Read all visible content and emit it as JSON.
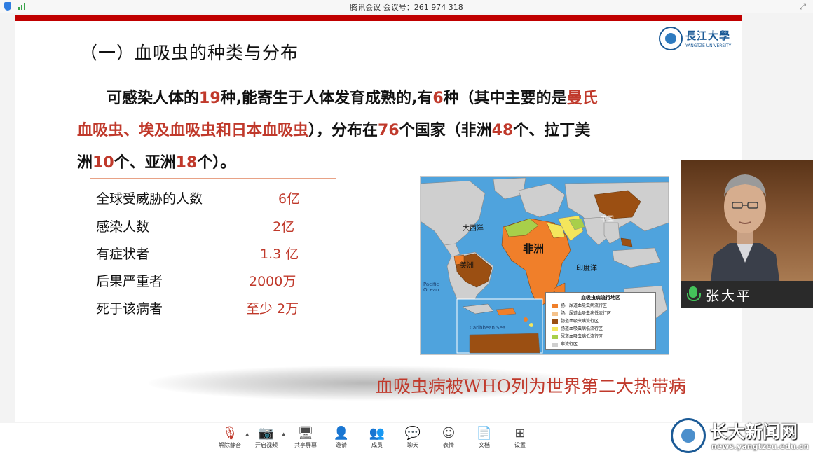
{
  "window": {
    "title": "腾讯会议 会议号：261 974 318"
  },
  "slide": {
    "title": "（一）血吸虫的种类与分布",
    "logo": {
      "cn": "長江大學",
      "en": "YANGTZE UNIVERSITY"
    },
    "paragraph": {
      "line1": [
        {
          "text": "可感染人体的",
          "hl": false
        },
        {
          "text": "19",
          "hl": true
        },
        {
          "text": "种,能寄生于人体发育成熟的,有",
          "hl": false
        },
        {
          "text": "6",
          "hl": true
        },
        {
          "text": "种（其中主要的是",
          "hl": false
        },
        {
          "text": "曼氏",
          "hl": true
        }
      ],
      "line2": [
        {
          "text": "血吸虫、埃及血吸虫和日本血吸虫",
          "hl": true
        },
        {
          "text": "），分布在",
          "hl": false
        },
        {
          "text": "76",
          "hl": true
        },
        {
          "text": "个国家（非洲",
          "hl": false
        },
        {
          "text": "48",
          "hl": true
        },
        {
          "text": "个、拉丁美",
          "hl": false
        }
      ],
      "line3": [
        {
          "text": "洲",
          "hl": false
        },
        {
          "text": "10",
          "hl": true
        },
        {
          "text": "个、亚洲",
          "hl": false
        },
        {
          "text": "18",
          "hl": true
        },
        {
          "text": "个）。",
          "hl": false
        }
      ]
    },
    "stats": [
      {
        "label": "全球受威胁的人数",
        "value": "6亿"
      },
      {
        "label": "感染人数",
        "value": "2亿"
      },
      {
        "label": "有症状者",
        "value": "1.3 亿"
      },
      {
        "label": "后果严重者",
        "value": "2000万"
      },
      {
        "label": "死于该病者",
        "value": "至少 2万"
      }
    ],
    "map": {
      "labels": {
        "atlantic": "大西洋",
        "africa": "非洲",
        "china": "中国",
        "americas": "美洲",
        "indian": "印度洋",
        "pacific": "Pacific Ocean",
        "caribbean": "Caribbean Sea"
      },
      "legend": {
        "title": "血吸虫病流行地区",
        "items": [
          {
            "text": "肠、尿道血吸虫病流行区",
            "color": "#f07f2a"
          },
          {
            "text": "肠、尿道血吸虫病低流行区",
            "color": "#f5c28b"
          },
          {
            "text": "肠道血吸虫病流行区",
            "color": "#9b4f12"
          },
          {
            "text": "肠道血吸虫病低流行区",
            "color": "#f4e65c"
          },
          {
            "text": "尿道血吸虫病低流行区",
            "color": "#a8cf4a"
          },
          {
            "text": "非流行区",
            "color": "#cfcfcf"
          }
        ]
      }
    },
    "footer_statement": "血吸虫病被WHO列为世界第二大热带病"
  },
  "video": {
    "name": "张大平"
  },
  "toolbar": {
    "items": [
      {
        "label": "解除静音",
        "icon": "microphone-muted-icon",
        "glyph": "🎙"
      },
      {
        "label": "开启视频",
        "icon": "camera-off-icon",
        "glyph": "📷"
      },
      {
        "label": "共享屏幕",
        "icon": "share-screen-icon",
        "glyph": "🖥"
      },
      {
        "label": "邀请",
        "icon": "invite-user-icon",
        "glyph": "👤"
      },
      {
        "label": "成员",
        "icon": "members-icon",
        "glyph": "👥"
      },
      {
        "label": "聊天",
        "icon": "chat-icon",
        "glyph": "💬"
      },
      {
        "label": "表情",
        "icon": "emoji-icon",
        "glyph": "☺"
      },
      {
        "label": "文档",
        "icon": "document-icon",
        "glyph": "📄"
      },
      {
        "label": "设置",
        "icon": "settings-grid-icon",
        "glyph": "⊞"
      }
    ]
  },
  "watermark": {
    "title": "长大新闻网",
    "url": "news.yangtzeu.edu.cn"
  }
}
